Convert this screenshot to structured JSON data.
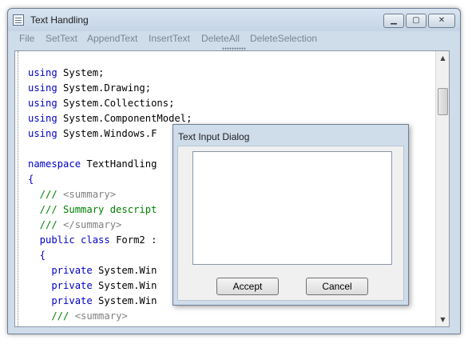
{
  "window": {
    "title": "Text Handling",
    "controls": {
      "minimize": "▁",
      "maximize": "▢",
      "close": "✕"
    }
  },
  "menu": {
    "items": [
      "File",
      "SetText",
      "AppendText",
      "InsertText",
      "DeleteAll",
      "DeleteSelection"
    ]
  },
  "editor": {
    "lines": [
      [
        {
          "t": "using",
          "c": "kw"
        },
        {
          "t": " System;",
          "c": ""
        }
      ],
      [
        {
          "t": "using",
          "c": "kw"
        },
        {
          "t": " System.Drawing;",
          "c": ""
        }
      ],
      [
        {
          "t": "using",
          "c": "kw"
        },
        {
          "t": " System.Collections;",
          "c": ""
        }
      ],
      [
        {
          "t": "using",
          "c": "kw"
        },
        {
          "t": " System.ComponentModel;",
          "c": ""
        }
      ],
      [
        {
          "t": "using",
          "c": "kw"
        },
        {
          "t": " System.Windows.F",
          "c": ""
        }
      ],
      [],
      [
        {
          "t": "namespace",
          "c": "kw"
        },
        {
          "t": " TextHandling",
          "c": ""
        }
      ],
      [
        {
          "t": "{",
          "c": "kw"
        }
      ],
      [
        {
          "t": "  ///",
          "c": "cm"
        },
        {
          "t": " <summary>",
          "c": "tag"
        }
      ],
      [
        {
          "t": "  /// Summary descript",
          "c": "cm"
        }
      ],
      [
        {
          "t": "  ///",
          "c": "cm"
        },
        {
          "t": " </summary>",
          "c": "tag"
        }
      ],
      [
        {
          "t": "  public class",
          "c": "kw"
        },
        {
          "t": " Form2 :",
          "c": ""
        }
      ],
      [
        {
          "t": "  {",
          "c": "kw"
        }
      ],
      [
        {
          "t": "    private",
          "c": "kw"
        },
        {
          "t": " System.Win",
          "c": ""
        }
      ],
      [
        {
          "t": "    private",
          "c": "kw"
        },
        {
          "t": " System.Win",
          "c": ""
        }
      ],
      [
        {
          "t": "    private",
          "c": "kw"
        },
        {
          "t": " System.Win",
          "c": ""
        }
      ],
      [
        {
          "t": "    ///",
          "c": "cm"
        },
        {
          "t": " <summary>",
          "c": "tag"
        }
      ]
    ],
    "scroll": {
      "up": "▲",
      "down": "▼"
    }
  },
  "dialog": {
    "title": "Text Input Dialog",
    "input_value": "",
    "accept_label": "Accept",
    "cancel_label": "Cancel"
  }
}
